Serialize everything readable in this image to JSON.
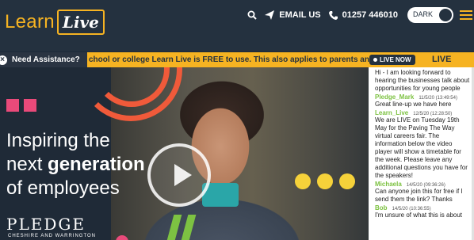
{
  "header": {
    "logo_learn": "Learn",
    "logo_live": "Live",
    "email_label": "EMAIL US",
    "phone_label": "01257 446010",
    "dark_label": "DARK",
    "icons": [
      "search-icon",
      "send-icon",
      "phone-icon",
      "menu-icon"
    ]
  },
  "assist_bar": {
    "label": "Need Assistance?",
    "marquee_text": "chool or college Learn Live is FREE to use. This also applies to parents and",
    "live_now": "LIVE NOW",
    "live_chat": "LIVE CHAT"
  },
  "hero": {
    "line1": "Inspiring the",
    "line2_pre": "next ",
    "line2_bold": "generation",
    "line3": "of employees",
    "pledge": "PLEDGE",
    "pledge_sub": "CHESHIRE AND WARRINGTON"
  },
  "chat": {
    "intro": "Hi - I am looking forward to hearing the businesses talk about opportunities for young people",
    "messages": [
      {
        "name": "Pledge_Mark",
        "time": "11/5/20 (13:49:54)",
        "text": "Great line-up we have here"
      },
      {
        "name": "Learn_Live",
        "time": "12/5/20 (12:28:50)",
        "text": "We are LIVE on Tuesday 19th May for the Paving The Way virtual careers fair. The information below the video player will show a timetable for the week. Please leave any additional questions you have for the speakers!"
      },
      {
        "name": "Michaela",
        "time": "14/5/20 (09:36:26)",
        "text": "Can anyone join this for free if I send them the link? Thanks"
      },
      {
        "name": "Bob",
        "time": "14/5/20 (10:36:55)",
        "text": "I'm unsure of what this is about"
      }
    ]
  },
  "colors": {
    "brand_yellow": "#f6b322",
    "header_bg": "#24313f",
    "accent_green": "#7dc242",
    "accent_pink": "#e94a7a",
    "accent_orange": "#f05a3a"
  }
}
